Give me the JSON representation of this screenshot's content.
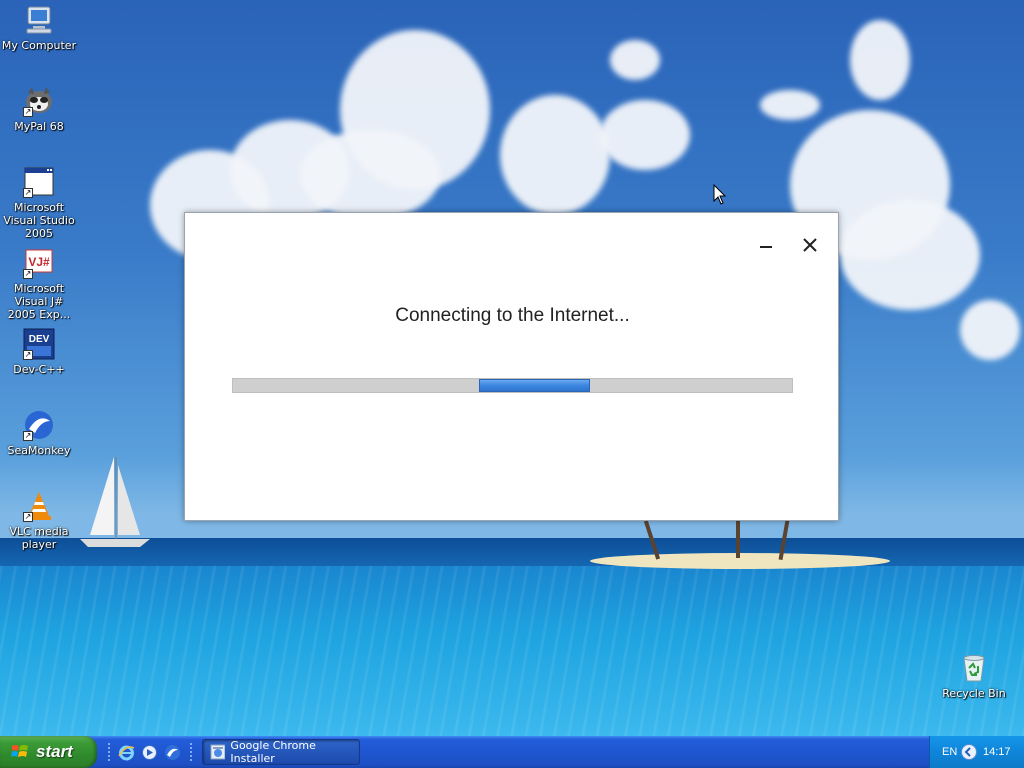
{
  "desktop": {
    "icons": [
      {
        "label": "My Computer",
        "icon": "my-computer-icon"
      },
      {
        "label": "MyPal 68",
        "icon": "mypal-icon"
      },
      {
        "label": "Microsoft Visual Studio 2005",
        "icon": "visual-studio-icon"
      },
      {
        "label": "Microsoft Visual J# 2005 Exp...",
        "icon": "visual-jsharp-icon"
      },
      {
        "label": "Dev-C++",
        "icon": "dev-cpp-icon"
      },
      {
        "label": "SeaMonkey",
        "icon": "seamonkey-icon"
      },
      {
        "label": "VLC media player",
        "icon": "vlc-icon"
      },
      {
        "label": "Recycle Bin",
        "icon": "recycle-bin-icon"
      }
    ],
    "devcpp_badge": "DEV",
    "vjsharp_badge": "VJ#"
  },
  "installer": {
    "status": "Connecting to the Internet...",
    "progress_state": "indeterminate",
    "minimize_icon": "minimize-icon",
    "close_icon": "close-icon"
  },
  "taskbar": {
    "start_label": "start",
    "quick_launch": [
      "internet-explorer-icon",
      "media-icon",
      "seamonkey-icon"
    ],
    "task_buttons": [
      {
        "label": "Google Chrome Installer",
        "icon": "chrome-installer-icon"
      }
    ],
    "tray": {
      "language": "EN",
      "clock": "14:17"
    }
  },
  "colors": {
    "taskbar_blue": "#245edb",
    "start_green": "#3c9c37",
    "progress_blue": "#3c86e0",
    "tray_blue": "#0f85d9"
  }
}
